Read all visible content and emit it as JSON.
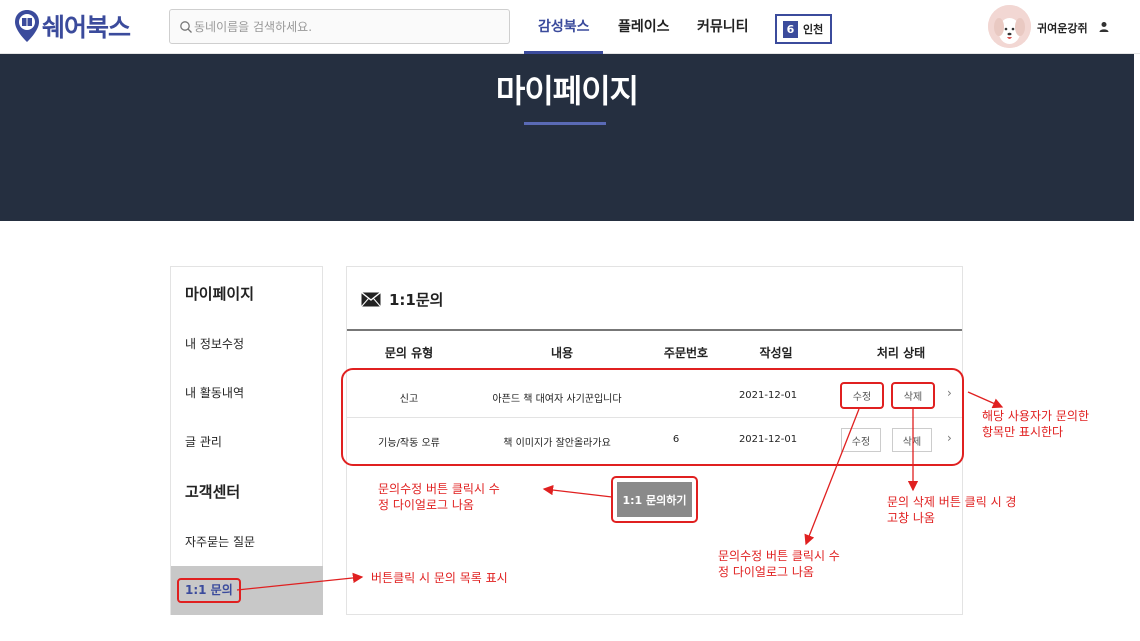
{
  "header": {
    "logo_text": "쉐어북스",
    "search_placeholder": "동네이름을 검색하세요.",
    "nav": [
      "감성북스",
      "플레이스",
      "커뮤니티"
    ],
    "region_number": "6",
    "region_name": "인천",
    "username": "귀여운강쥐",
    "brand_color": "#3b4b9c"
  },
  "banner": {
    "title": "마이페이지",
    "bg_color": "#252f40"
  },
  "sidebar": {
    "heading_mypage": "마이페이지",
    "items_mypage": [
      "내 정보수정",
      "내 활동내역",
      "글 관리"
    ],
    "heading_support": "고객센터",
    "faq": "자주묻는 질문",
    "active_item": "1:1 문의"
  },
  "panel": {
    "title": "1:1문의",
    "columns": [
      "문의 유형",
      "내용",
      "주문번호",
      "작성일",
      "처리 상태"
    ],
    "rows": [
      {
        "type": "신고",
        "content": "아픈드 책 대여자 사기꾼입니다",
        "order_no": "",
        "date": "2021-12-01"
      },
      {
        "type": "기능/작동 오류",
        "content": "책 이미지가 잘안올라가요",
        "order_no": "6",
        "date": "2021-12-01"
      }
    ],
    "edit_label": "수정",
    "delete_label": "삭제",
    "ask_button": "1:1 문의하기"
  },
  "annotations": {
    "rows_note_1": "해당 사용자가 문의한",
    "rows_note_2": "항목만 표시한다",
    "ask_note_1": "문의수정 버튼 클릭시 수",
    "ask_note_2": "정 다이얼로그 나옴",
    "edit_note_1": "문의수정 버튼 클릭시 수",
    "edit_note_2": "정 다이얼로그 나옴",
    "delete_note_1": "문의 삭제 버튼 클릭 시 경",
    "delete_note_2": "고창 나옴",
    "sidebar_note": "버튼클릭 시 문의 목록 표시",
    "annotation_color": "#e02020"
  }
}
